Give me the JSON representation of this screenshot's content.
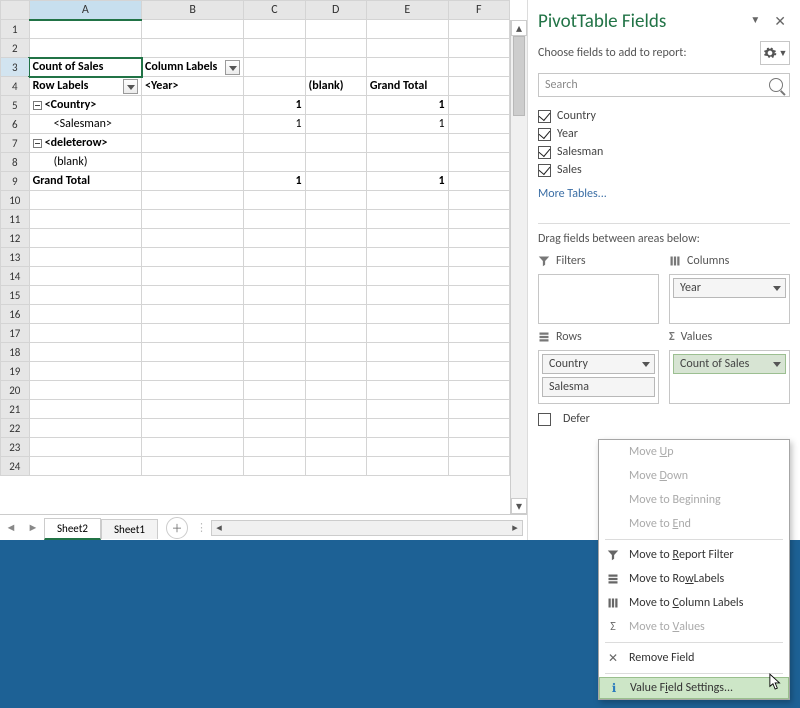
{
  "grid": {
    "cols": [
      "A",
      "B",
      "C",
      "D",
      "E",
      "F"
    ],
    "rows": [
      "1",
      "2",
      "3",
      "4",
      "5",
      "6",
      "7",
      "8",
      "9",
      "10",
      "11",
      "12",
      "13",
      "14",
      "15",
      "16",
      "17",
      "18",
      "19",
      "20",
      "21",
      "22",
      "23",
      "24"
    ],
    "a3": "Count of Sales",
    "b3": "Column Labels",
    "a4": "Row Labels",
    "b4": "<Year>",
    "d4": "(blank)",
    "e4": "Grand Total",
    "a5": "<Country>",
    "c5": "1",
    "e5": "1",
    "a6": "<Salesman>",
    "c6": "1",
    "e6": "1",
    "a7": "<deleterow>",
    "a8": "(blank)",
    "a9": "Grand Total",
    "c9": "1",
    "e9": "1"
  },
  "tabs": {
    "active": "Sheet2",
    "other": "Sheet1"
  },
  "panel": {
    "title": "PivotTable Fields",
    "subtitle": "Choose fields to add to report:",
    "search_placeholder": "Search",
    "fields": [
      "Country",
      "Year",
      "Salesman",
      "Sales"
    ],
    "more": "More Tables...",
    "drag_label": "Drag fields between areas below:",
    "filters": "Filters",
    "columns": "Columns",
    "rows": "Rows",
    "values": "Values",
    "col_field": "Year",
    "row_field1": "Country",
    "row_field2": "Salesma",
    "val_field": "Count of Sales",
    "defer": "Defer"
  },
  "menu": {
    "moveup": "Move Up",
    "movedown": "Move Down",
    "movebeg": "Move to Beginning",
    "moveend": "Move to End",
    "mrf": "Move to Report Filter",
    "mrl": "Move to Row Labels",
    "mcl": "Move to Column Labels",
    "mval": "Move to Values",
    "remove": "Remove Field",
    "vfs": "Value Field Settings...",
    "u": "U",
    "d": "D",
    "b": "B",
    "e": "E",
    "r": "R",
    "w": "w",
    "c": "C",
    "v": "V",
    "i": "i"
  }
}
